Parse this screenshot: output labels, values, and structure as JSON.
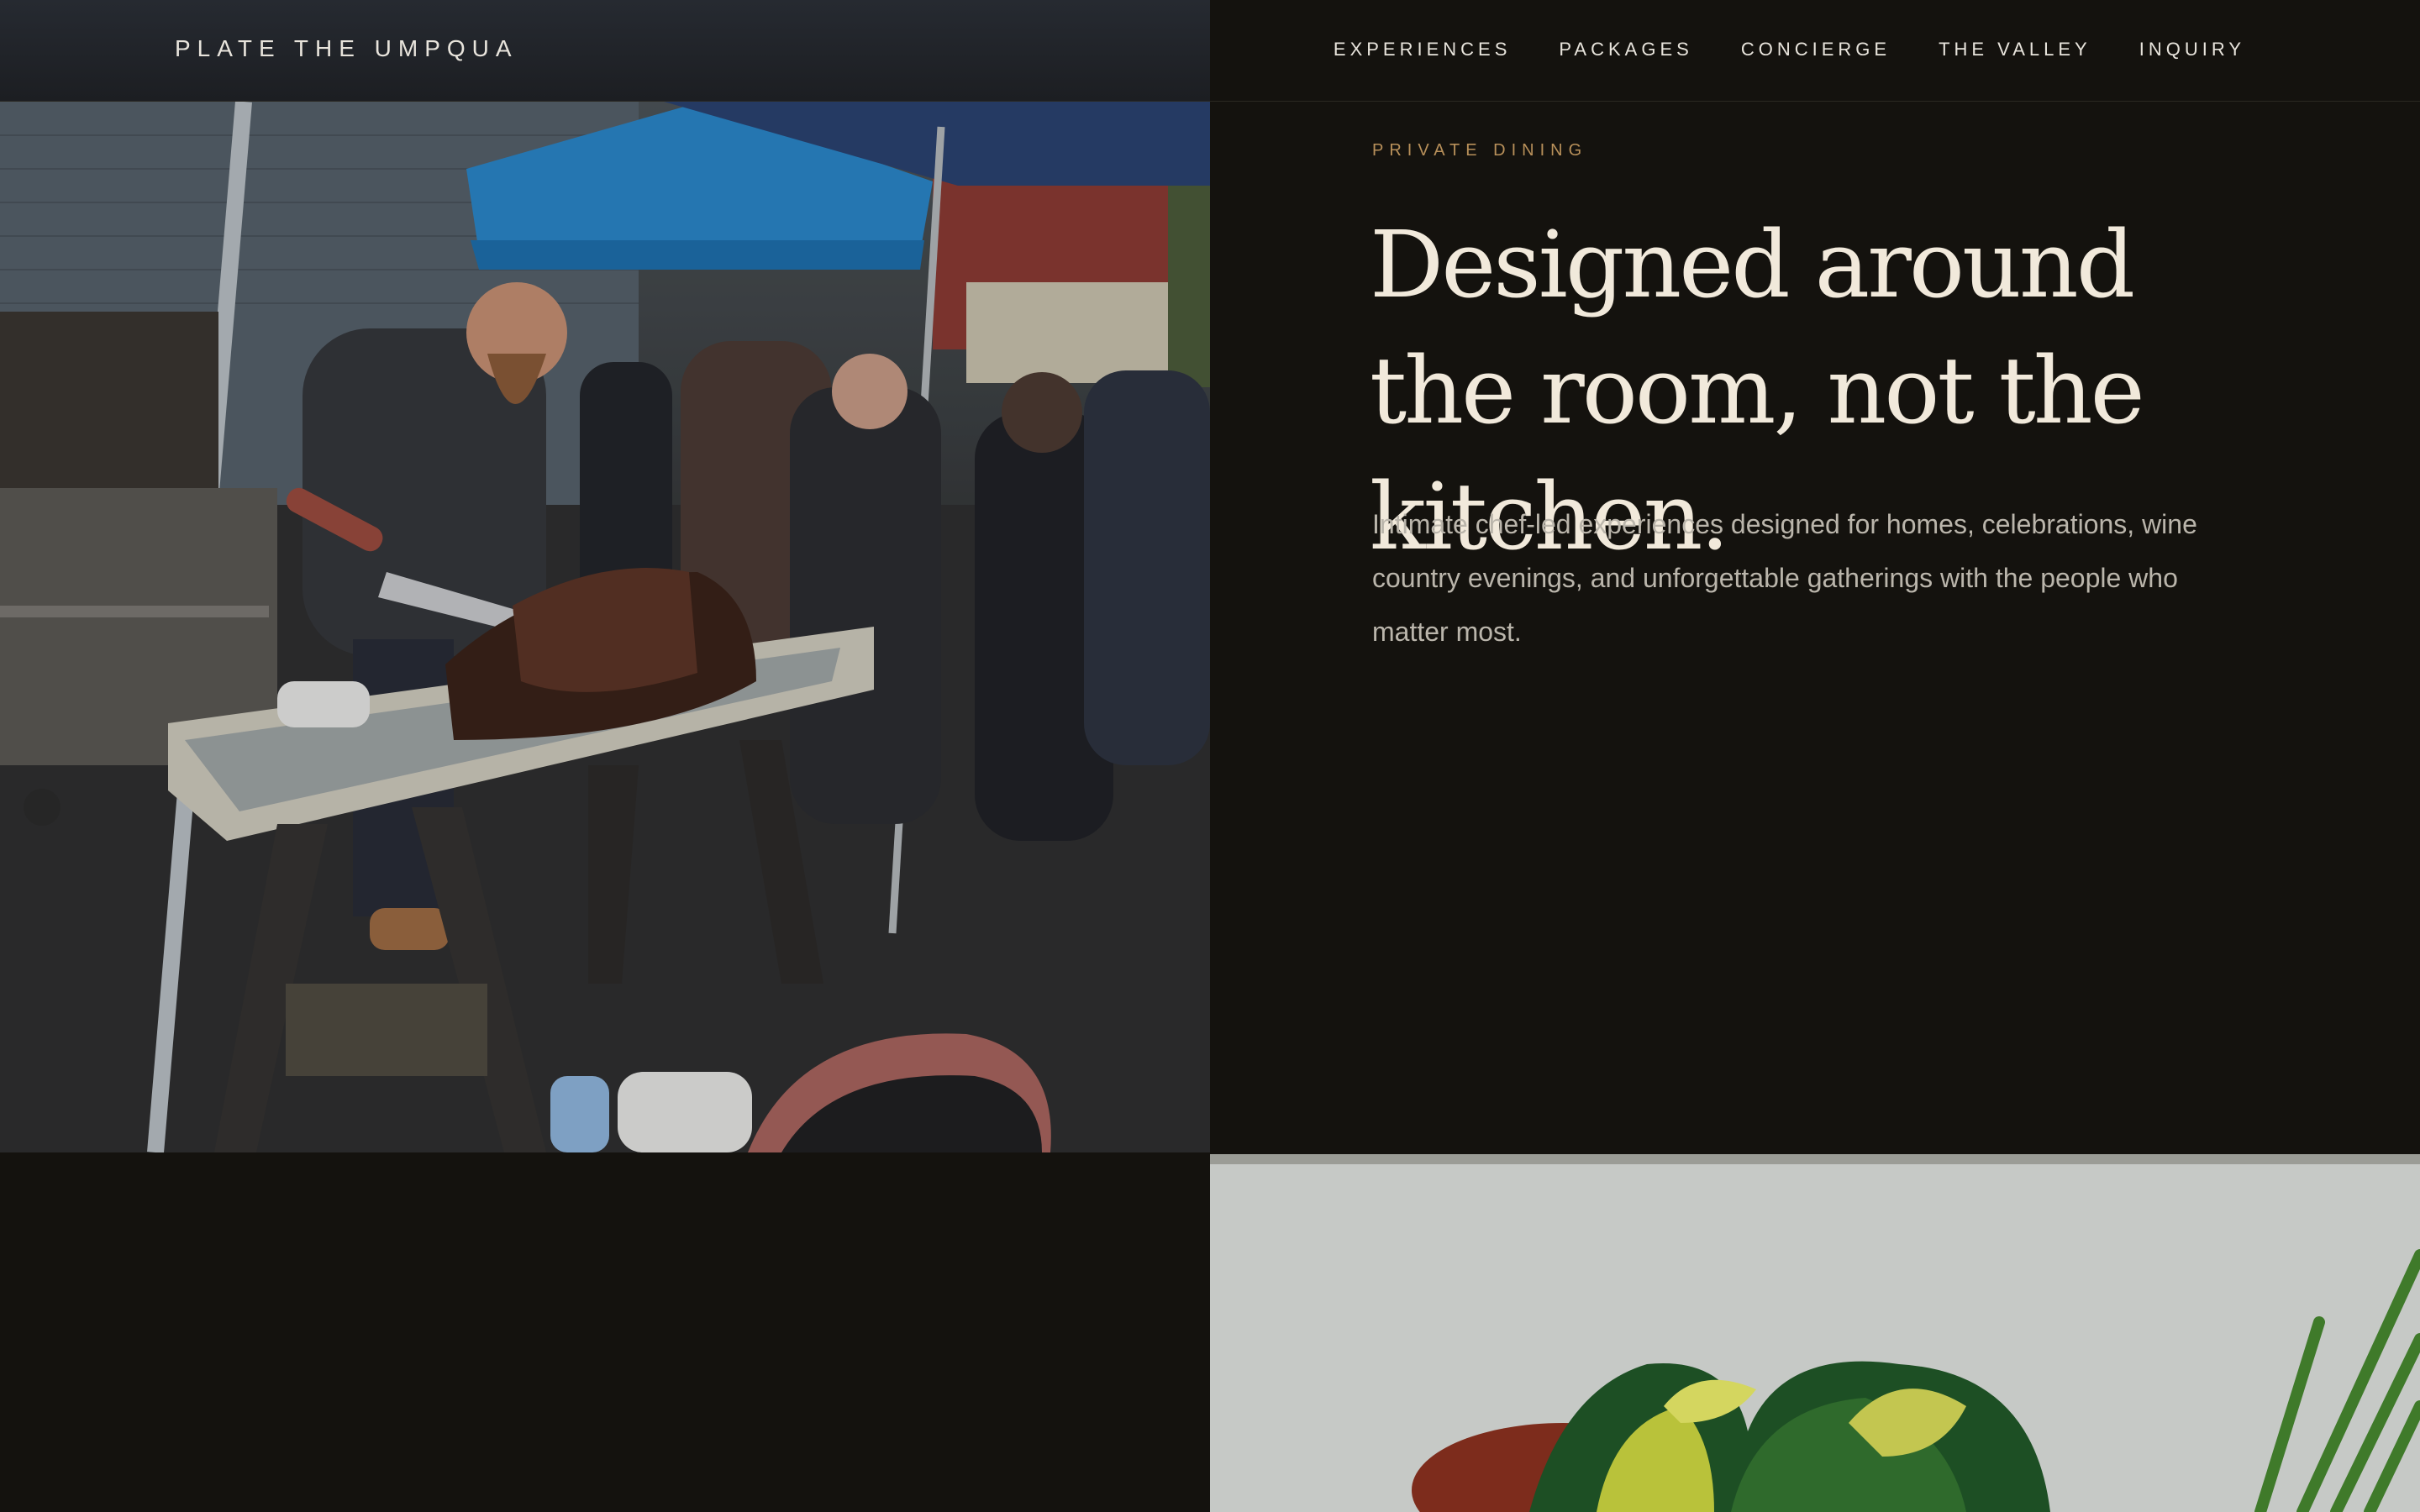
{
  "header": {
    "brand": "PLATE THE UMPQUA",
    "nav": [
      {
        "label": "EXPERIENCES"
      },
      {
        "label": "PACKAGES"
      },
      {
        "label": "CONCIERGE"
      },
      {
        "label": "THE VALLEY"
      },
      {
        "label": "INQUIRY"
      }
    ]
  },
  "hero": {
    "eyebrow": "PRIVATE DINING",
    "headline": "Designed around the room, not the kitchen.",
    "lede": "Intimate chef-led experiences designed for homes, celebrations, wine country evenings, and unforgettable gatherings with the people who matter most."
  },
  "colors": {
    "background": "#14120e",
    "accent": "#b8905a",
    "headline": "#f1e9db",
    "body_text": "#bab5ab"
  }
}
